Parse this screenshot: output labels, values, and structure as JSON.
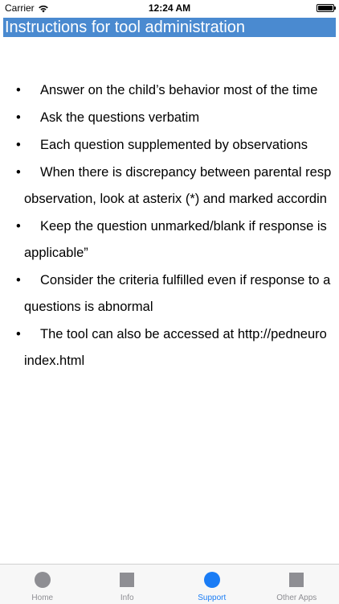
{
  "status_bar": {
    "carrier": "Carrier",
    "time": "12:24 AM"
  },
  "title": "Instructions for tool administration",
  "bullets": [
    {
      "lines": [
        "Answer on the child’s behavior most of the time"
      ]
    },
    {
      "lines": [
        "Ask the questions verbatim"
      ]
    },
    {
      "lines": [
        "Each question supplemented by observations"
      ]
    },
    {
      "lines": [
        "When there is discrepancy between parental resp",
        "observation, look at asterix (*) and marked accordin"
      ]
    },
    {
      "lines": [
        "Keep the question unmarked/blank if response is",
        "applicable”"
      ]
    },
    {
      "lines": [
        "Consider the criteria fulfilled even if response to a",
        "questions is abnormal"
      ]
    },
    {
      "lines": [
        "The tool can also be accessed at http://pedneuro",
        "index.html"
      ]
    }
  ],
  "bullet_symbol": "•",
  "tabs": [
    {
      "label": "Home",
      "icon": "circle-icon",
      "active": false
    },
    {
      "label": "Info",
      "icon": "square-icon",
      "active": false
    },
    {
      "label": "Support",
      "icon": "circle-icon",
      "active": true
    },
    {
      "label": "Other Apps",
      "icon": "square-icon",
      "active": false
    }
  ],
  "colors": {
    "title_bg": "#4a8ad0",
    "tab_active": "#1a7cf5",
    "tab_inactive": "#8e8e93"
  }
}
